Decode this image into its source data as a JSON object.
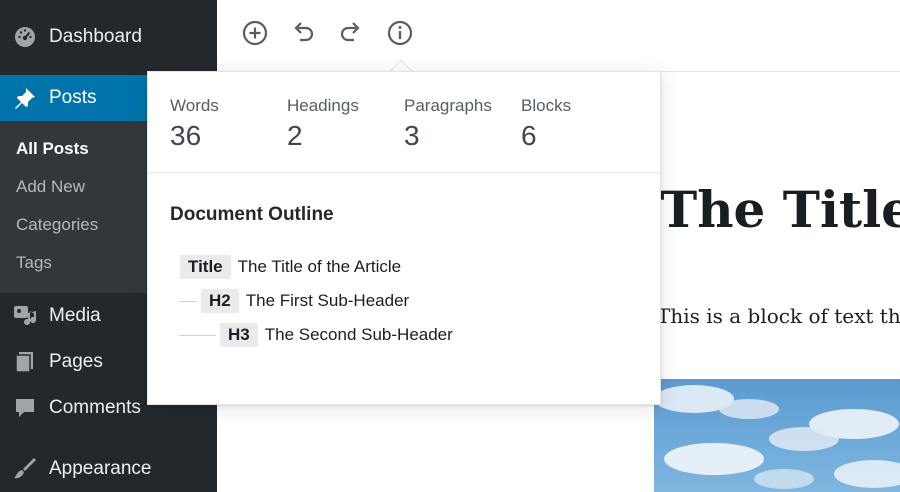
{
  "sidebar": {
    "items": [
      {
        "label": "Dashboard",
        "icon": "dashboard-icon"
      },
      {
        "label": "Posts",
        "icon": "pin-icon",
        "active": true
      },
      {
        "label": "Media",
        "icon": "media-icon"
      },
      {
        "label": "Pages",
        "icon": "pages-icon"
      },
      {
        "label": "Comments",
        "icon": "comment-icon"
      },
      {
        "label": "Appearance",
        "icon": "brush-icon"
      }
    ],
    "submenu": [
      "All Posts",
      "Add New",
      "Categories",
      "Tags"
    ],
    "current_submenu": "All Posts"
  },
  "toolbar": {
    "icons": [
      "add-block-icon",
      "undo-icon",
      "redo-icon",
      "info-icon"
    ]
  },
  "popover": {
    "stats": [
      {
        "label": "Words",
        "value": "36"
      },
      {
        "label": "Headings",
        "value": "2"
      },
      {
        "label": "Paragraphs",
        "value": "3"
      },
      {
        "label": "Blocks",
        "value": "6"
      }
    ],
    "outline_heading": "Document Outline",
    "outline": [
      {
        "level": "Title",
        "text": "The Title of the Article"
      },
      {
        "level": "H2",
        "text": "The First Sub-Header"
      },
      {
        "level": "H3",
        "text": "The Second Sub-Header"
      }
    ]
  },
  "editor": {
    "title": "The Title",
    "paragraph": "This is a block of text tha"
  },
  "colors": {
    "sidebar_bg": "#23282d",
    "submenu_bg": "#32373c",
    "accent": "#0073aa"
  }
}
